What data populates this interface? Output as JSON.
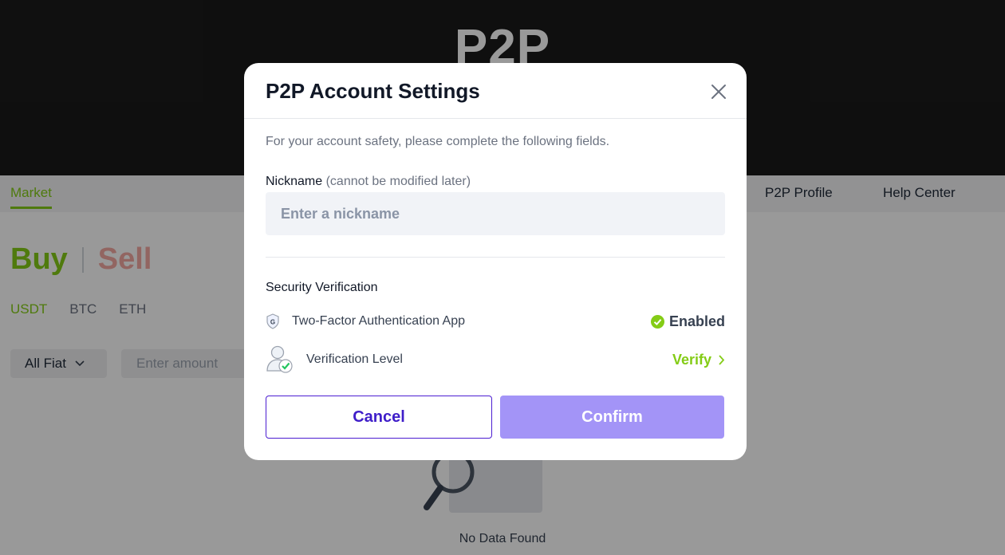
{
  "hero": {
    "title": "P2P"
  },
  "nav": {
    "market": "Market",
    "profile": "P2P Profile",
    "help": "Help Center"
  },
  "trade_toggle": {
    "buy": "Buy",
    "sell": "Sell"
  },
  "coins": [
    "USDT",
    "BTC",
    "ETH"
  ],
  "filters": {
    "fiat": "All Fiat",
    "amount_placeholder": "Enter amount"
  },
  "empty_state": {
    "text": "No Data Found"
  },
  "modal": {
    "title": "P2P Account Settings",
    "intro": "For your account safety, please complete the following fields.",
    "nickname_label": "Nickname",
    "nickname_note": "(cannot be modified later)",
    "nickname_placeholder": "Enter a nickname",
    "nickname_value": "",
    "security_title": "Security Verification",
    "two_factor_label": "Two-Factor Authentication App",
    "two_factor_status": "Enabled",
    "verification_label": "Verification Level",
    "verify_link": "Verify",
    "cancel_label": "Cancel",
    "confirm_label": "Confirm"
  },
  "colors": {
    "accent_green": "#84cc16",
    "accent_purple": "#3f1ec9",
    "confirm_disabled": "#a394f7",
    "sell_red": "#f4a8a2"
  }
}
